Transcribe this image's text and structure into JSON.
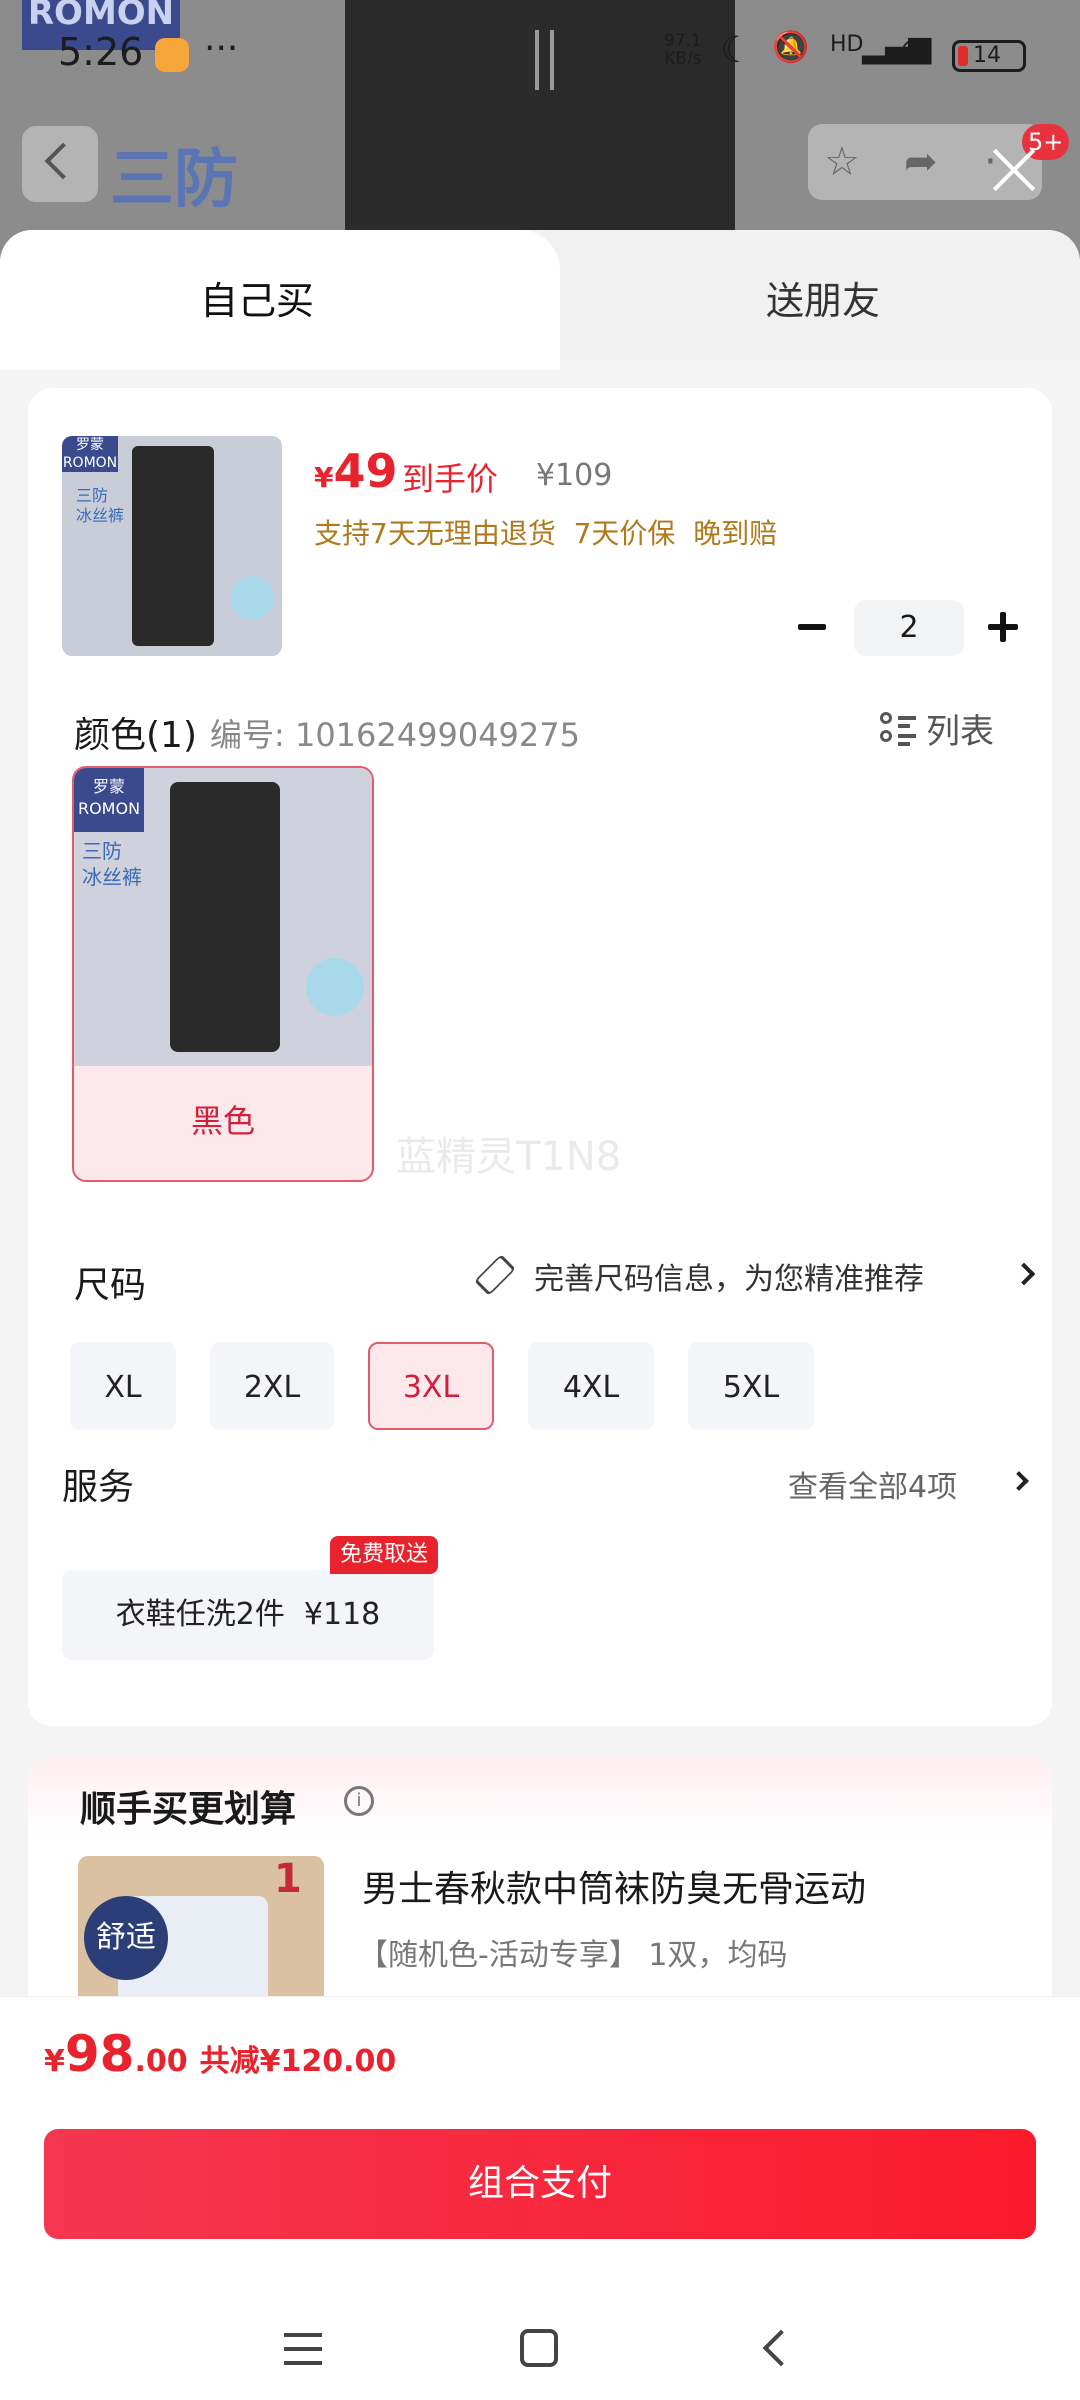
{
  "status_bar": {
    "time": "5:26",
    "more": "···",
    "net_speed": "97.1\nKB/s",
    "signal": "HD",
    "battery": "14"
  },
  "background_page": {
    "logo": "ROMON",
    "title": "三防",
    "notif_badge": "5+"
  },
  "tabs": [
    {
      "label": "自己买",
      "active": true
    },
    {
      "label": "送朋友",
      "active": false
    }
  ],
  "product": {
    "thumb_logo": "罗蒙\nROMON",
    "thumb_text": "三防\n冰丝裤",
    "price_symbol": "¥",
    "price": "49",
    "price_label": "到手价",
    "original_price": "¥109",
    "guarantees": "支持7天无理由退货  7天价保  晚到赔",
    "quantity": "2"
  },
  "color_section": {
    "heading": "颜色(1)",
    "code": "编号: 10162499049275",
    "list_label": "列表",
    "options": [
      {
        "name": "黑色",
        "logo": "罗蒙\nROMON",
        "text": "三防\n冰丝裤",
        "selected": true
      }
    ],
    "watermark": "蓝精灵T1N8"
  },
  "size_section": {
    "heading": "尺码",
    "tip": "完善尺码信息，为您精准推荐",
    "options": [
      {
        "label": "XL",
        "selected": false
      },
      {
        "label": "2XL",
        "selected": false
      },
      {
        "label": "3XL",
        "selected": true
      },
      {
        "label": "4XL",
        "selected": false
      },
      {
        "label": "5XL",
        "selected": false
      }
    ]
  },
  "service_section": {
    "heading": "服务",
    "view_all": "查看全部4项",
    "chip": "衣鞋任洗2件  ¥118",
    "chip_badge": "免费取送"
  },
  "bundle_section": {
    "title": "顺手买更划算",
    "info_icon": "i",
    "item_badge": "舒适",
    "item_count": "1",
    "item_name": "男士春秋款中筒袜防臭无骨运动",
    "item_desc": "【随机色-活动专享】 1双，均码"
  },
  "checkout": {
    "currency": "¥",
    "total_int": "98",
    "total_dec": ".00",
    "savings": "共减¥120.00",
    "pay_label": "组合支付"
  },
  "colors": {
    "accent_red": "#e8232e",
    "selected_bg": "#fde8ec",
    "guarantee_gold": "#b07a1c"
  }
}
